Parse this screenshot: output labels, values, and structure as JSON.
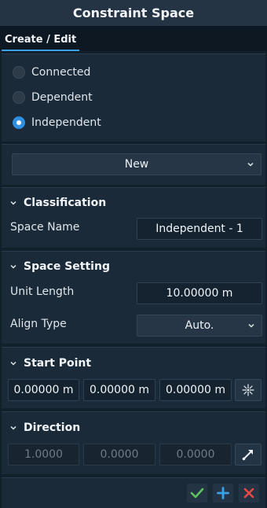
{
  "window": {
    "title": "Constraint Space"
  },
  "tabs": [
    {
      "label": "Create / Edit"
    }
  ],
  "space_type": {
    "options": [
      {
        "label": "Connected",
        "selected": false
      },
      {
        "label": "Dependent",
        "selected": false
      },
      {
        "label": "Independent",
        "selected": true
      }
    ]
  },
  "space_select": {
    "value": "New"
  },
  "classification": {
    "header": "Classification",
    "space_name_label": "Space Name",
    "space_name_value": "Independent - 1"
  },
  "space_setting": {
    "header": "Space Setting",
    "unit_length_label": "Unit Length",
    "unit_length_value": "10.00000 m",
    "align_type_label": "Align Type",
    "align_type_value": "Auto."
  },
  "start_point": {
    "header": "Start Point",
    "x": "0.00000 m",
    "y": "0.00000 m",
    "z": "0.00000 m",
    "pick_icon": "crosshair-star-icon"
  },
  "direction": {
    "header": "Direction",
    "x": "1.0000",
    "y": "0.0000",
    "z": "0.0000",
    "pick_icon": "arrow-diagonal-icon"
  },
  "footer": {
    "confirm_icon": "check-icon",
    "add_icon": "plus-icon",
    "cancel_icon": "close-icon"
  },
  "colors": {
    "accent": "#3aa0e8",
    "confirm": "#5cc45c",
    "add": "#3aa0e8",
    "cancel": "#e84848"
  }
}
